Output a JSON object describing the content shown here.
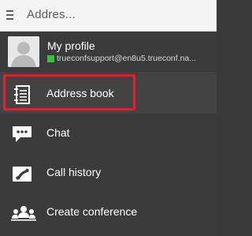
{
  "header": {
    "title": "Addres..."
  },
  "profile": {
    "name": "My profile",
    "email": "trueconfsupport@en8u5.trueconf.na...",
    "status_color": "#35c335"
  },
  "menu": {
    "items": [
      {
        "label": "Address book",
        "icon": "address-book-icon",
        "selected": true
      },
      {
        "label": "Chat",
        "icon": "chat-icon",
        "selected": false
      },
      {
        "label": "Call history",
        "icon": "call-history-icon",
        "selected": false
      },
      {
        "label": "Create conference",
        "icon": "conference-icon",
        "selected": false
      }
    ]
  },
  "colors": {
    "highlight": "#e0202c",
    "drawer_bg": "#3b3b3b",
    "topbar_bg": "#f4f4f4"
  }
}
